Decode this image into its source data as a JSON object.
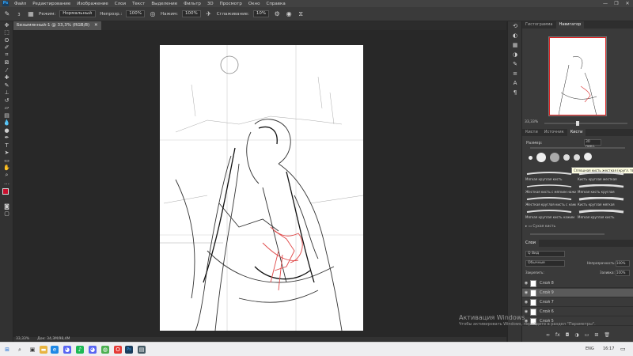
{
  "app": {
    "logo_text": "Ps"
  },
  "menu": {
    "items": [
      "Файл",
      "Редактирование",
      "Изображение",
      "Слои",
      "Текст",
      "Выделение",
      "Фильтр",
      "3D",
      "Просмотр",
      "Окно",
      "Справка"
    ]
  },
  "window_controls": {
    "minimize": "—",
    "restore": "❐",
    "close": "✕"
  },
  "options": {
    "mode_label": "Режим:",
    "mode_value": "Нормальный",
    "opacity_label": "Непрозр.:",
    "opacity_value": "100%",
    "flow_label": "Нажим:",
    "flow_value": "100%",
    "smoothing_label": "Сглаживание:",
    "smoothing_value": "10%",
    "brush_size": "3"
  },
  "document": {
    "tab_title": "Безымянный-1 @ 33,3% (RGB/8)",
    "tab_close": "✕"
  },
  "status": {
    "zoom": "33,33%",
    "doc_info": "Док: 34,3M/98,4M"
  },
  "navigator": {
    "tabs": [
      "Гистограмма",
      "Навигатор"
    ],
    "active_tab": "Навигатор",
    "zoom": "33,33%"
  },
  "brushes": {
    "tabs": [
      "Кисти",
      "Источник",
      "Кисти"
    ],
    "size_label": "Размер:",
    "size_value": "30 пикс.",
    "tooltip": "Сплошная кисть жесткая (кругл. тв.)",
    "cells": [
      "Мягкая круглая кисть",
      "Кисть круглая жесткая",
      "Жесткая кисть с мягким нажимом",
      "Мягкая кисть круглая",
      "Жесткая круглая кисть с нажимом",
      "Кисть круглая мягкая",
      "Мягкая круглая кисть нажим",
      "Мягкая круглая кисть"
    ],
    "group_label": "Сухая кисть"
  },
  "layers": {
    "tab": "Слои",
    "filter_label": "Q Вид",
    "blend_mode": "Обычные",
    "opacity_label": "Непрозрачность:",
    "opacity_value": "100%",
    "lock_label": "Закрепить:",
    "fill_label": "Заливка:",
    "fill_value": "100%",
    "rows": [
      {
        "name": "Слой 8",
        "selected": false
      },
      {
        "name": "Слой 9",
        "selected": true
      },
      {
        "name": "Слой 7",
        "selected": false
      },
      {
        "name": "Слой 6",
        "selected": false
      },
      {
        "name": "Слой 5",
        "selected": false
      }
    ]
  },
  "activation": {
    "title": "Активация Windows",
    "subtitle": "Чтобы активировать Windows, перейдите в раздел \"Параметры\"."
  },
  "taskbar": {
    "time": "16:17",
    "lang": "ENG"
  },
  "colors": {
    "foreground": "#c8102e",
    "background": "#ffffff",
    "canvas": "#ffffff",
    "accent": "#31a8ff"
  }
}
